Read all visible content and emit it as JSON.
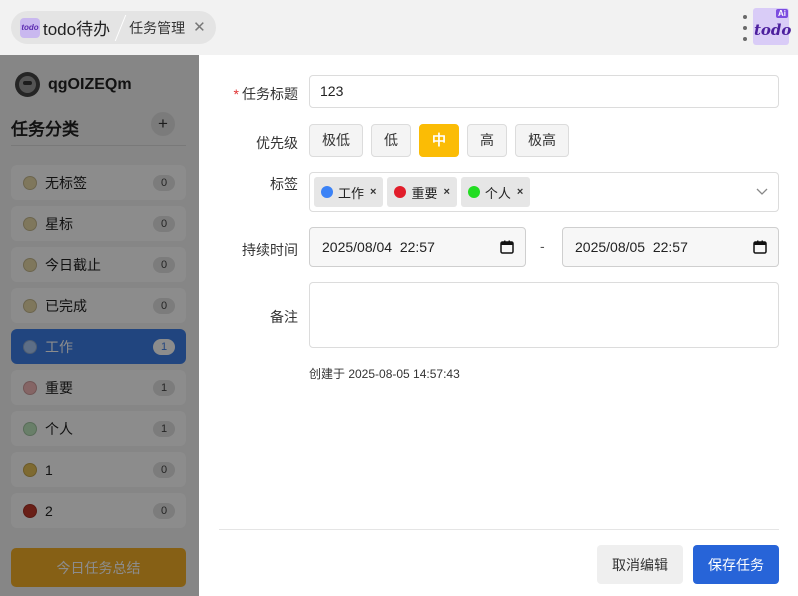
{
  "header": {
    "logo_text": "todo",
    "home_tab_label": "todo待办",
    "current_tab_label": "任务管理",
    "close_glyph": "✕",
    "app_logo_text": "todo",
    "app_logo_badge": "Ai"
  },
  "sidebar": {
    "username": "qgOIZEQm",
    "categories_title": "任务分类",
    "add_glyph": "+",
    "items": [
      {
        "label": "无标签",
        "count": "0",
        "color": "#e8d9a8",
        "active": false
      },
      {
        "label": "星标",
        "count": "0",
        "color": "#e8d9a8",
        "active": false
      },
      {
        "label": "今日截止",
        "count": "0",
        "color": "#e8d9a8",
        "active": false
      },
      {
        "label": "已完成",
        "count": "0",
        "color": "#e8d9a8",
        "active": false
      },
      {
        "label": "工作",
        "count": "1",
        "color": "#a9c8f5",
        "active": true
      },
      {
        "label": "重要",
        "count": "1",
        "color": "#f2b8b8",
        "active": false
      },
      {
        "label": "个人",
        "count": "1",
        "color": "#bfe8bf",
        "active": false
      },
      {
        "label": "1",
        "count": "0",
        "color": "#e6c15a",
        "active": false
      },
      {
        "label": "2",
        "count": "0",
        "color": "#c0392b",
        "active": false
      }
    ],
    "summary_button": "今日任务总结"
  },
  "form": {
    "title_label": "任务标题",
    "required_mark": "*",
    "title_value": "123",
    "priority_label": "优先级",
    "priorities": [
      {
        "label": "极低",
        "active": false
      },
      {
        "label": "低",
        "active": false
      },
      {
        "label": "中",
        "active": true
      },
      {
        "label": "高",
        "active": false
      },
      {
        "label": "极高",
        "active": false
      }
    ],
    "tags_label": "标签",
    "tags": [
      {
        "label": "工作",
        "color": "#3b82f6"
      },
      {
        "label": "重要",
        "color": "#e11d2a"
      },
      {
        "label": "个人",
        "color": "#22dd22"
      }
    ],
    "tag_remove_glyph": "×",
    "duration_label": "持续时间",
    "start_datetime": "2025/08/04  22:57",
    "end_datetime": "2025/08/05  22:57",
    "date_separator": "-",
    "notes_label": "备注",
    "notes_value": "",
    "created_text": "创建于 2025-08-05 14:57:43",
    "cancel_button": "取消编辑",
    "save_button": "保存任务"
  },
  "colors": {
    "accent_blue": "#2764d8",
    "priority_active": "#fbbc05",
    "summary_orange": "#f5b027",
    "sidebar_active": "#3d7fe8"
  }
}
